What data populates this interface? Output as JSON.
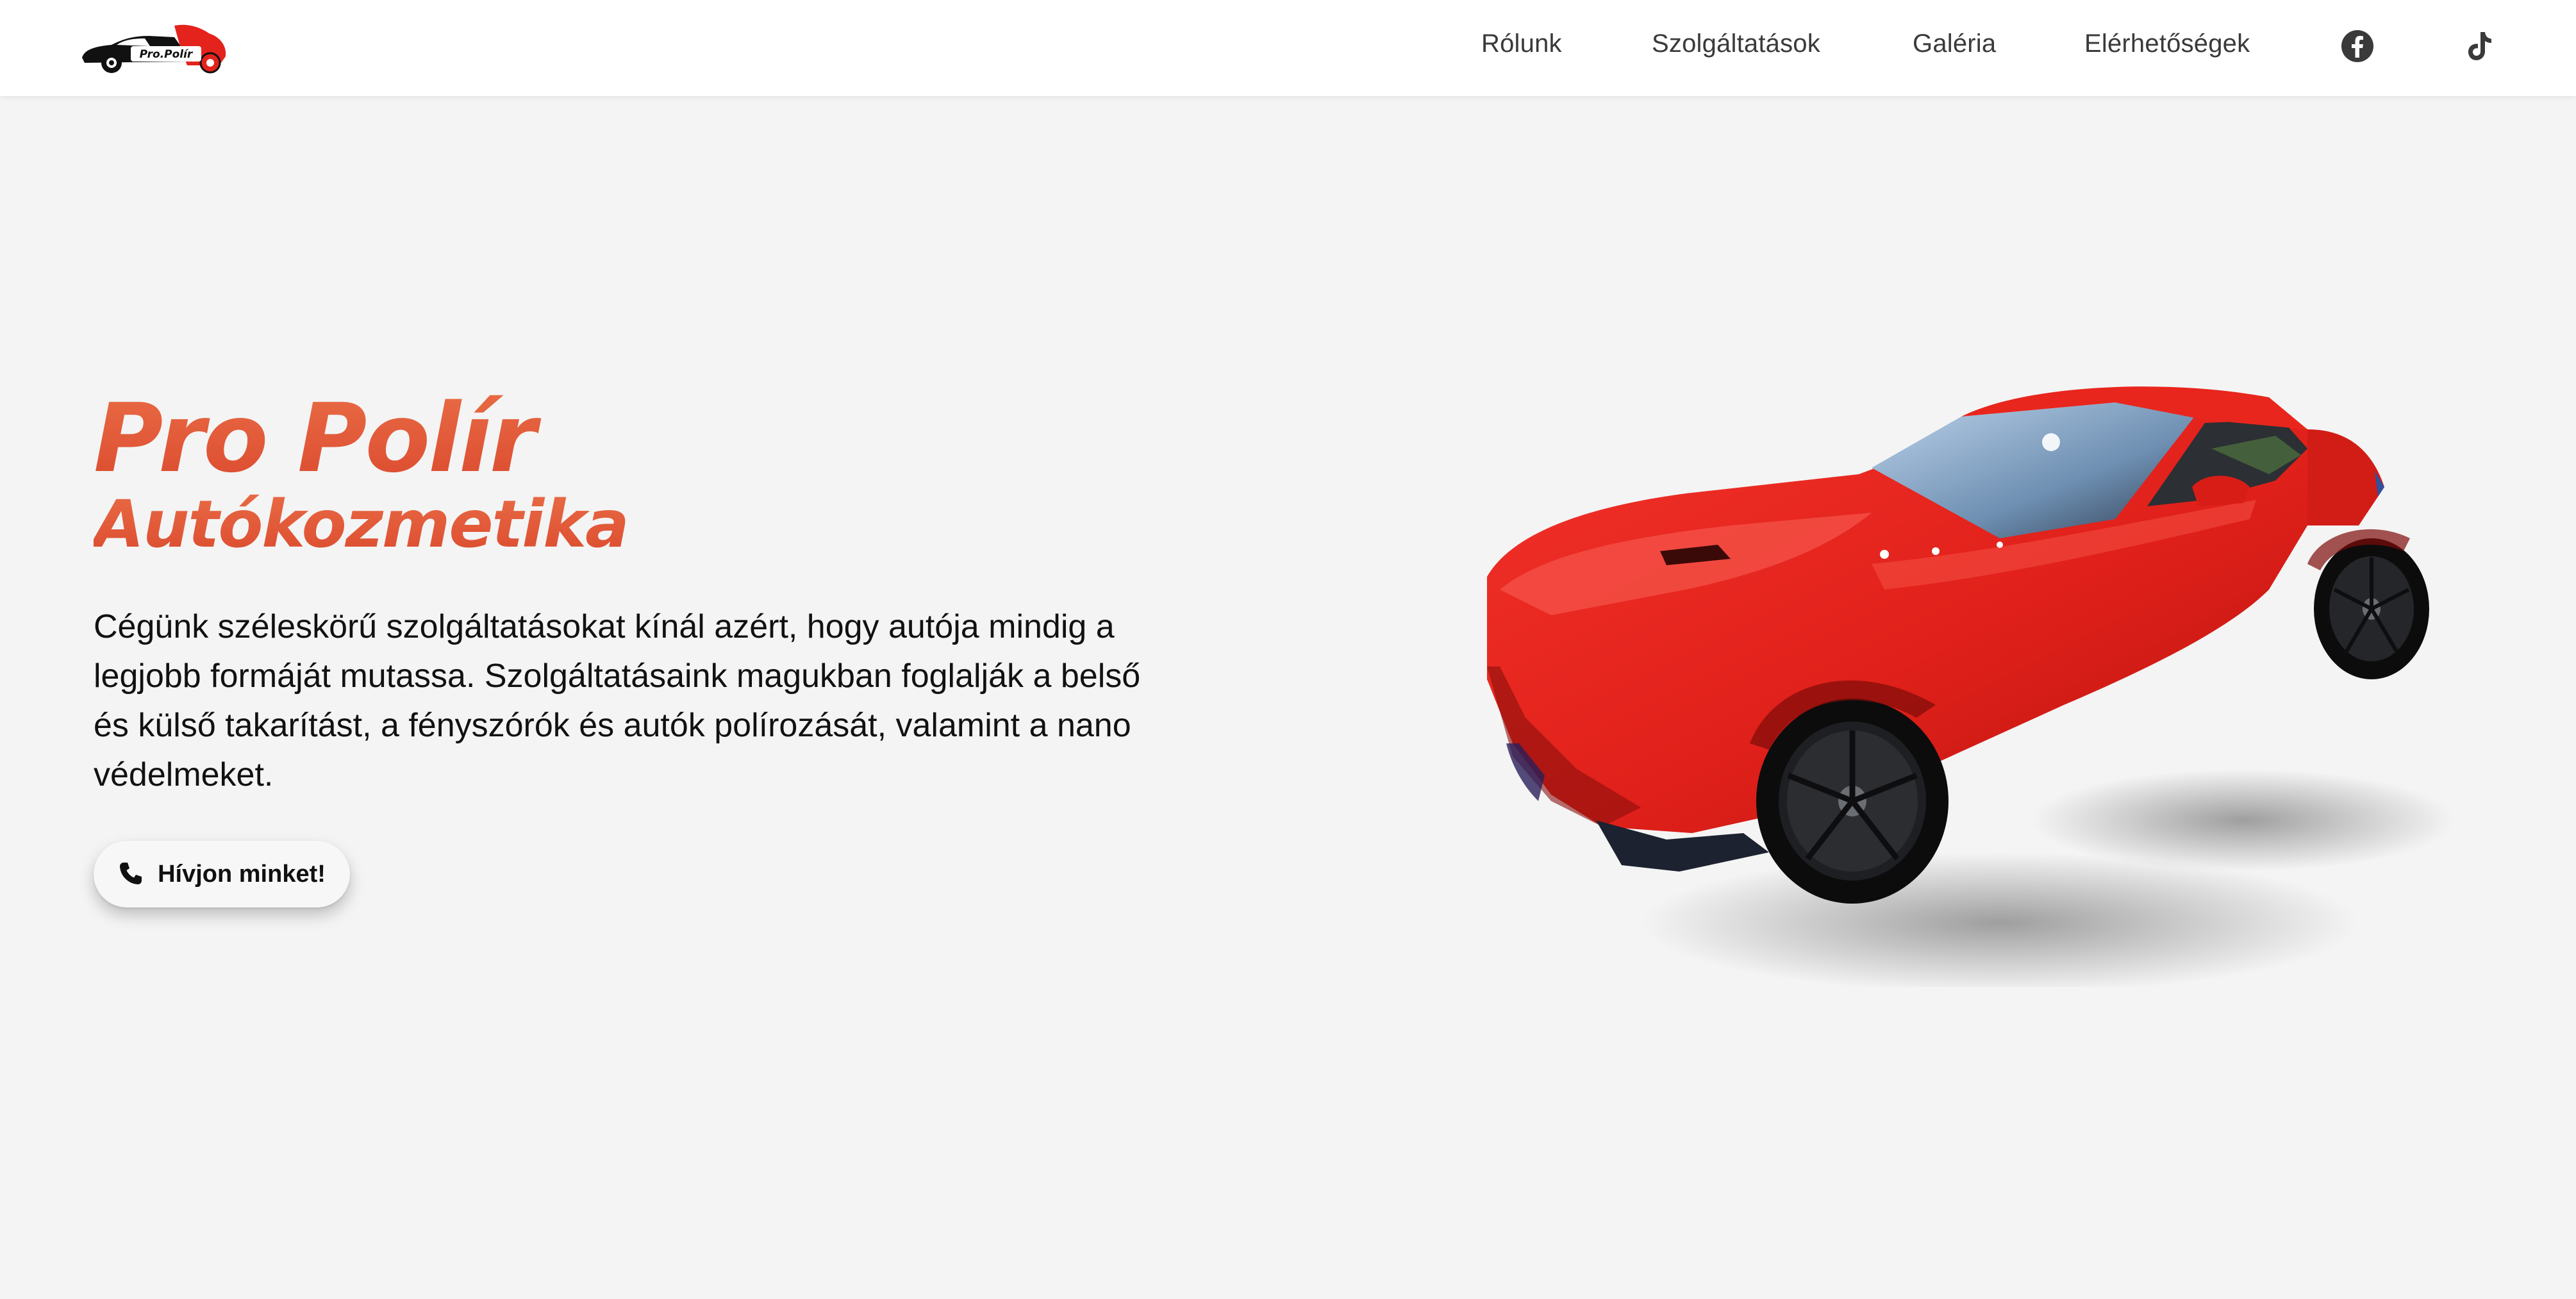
{
  "header": {
    "logo_text": "Pro.Polír",
    "nav": [
      {
        "label": "Rólunk"
      },
      {
        "label": "Szolgáltatások"
      },
      {
        "label": "Galéria"
      },
      {
        "label": "Elérhetőségek"
      }
    ],
    "social": [
      {
        "icon": "facebook-icon"
      },
      {
        "icon": "tiktok-icon"
      }
    ]
  },
  "hero": {
    "title": "Pro Polír",
    "subtitle": "Autókozmetika",
    "description": "Cégünk széleskörű szolgáltatásokat kínál azért, hogy autója mindig a legjobb formáját mutassa. Szolgáltatásaink magukban foglalják a belső és külső takarítást, a fényszórók és autók polírozását, valamint a nano védelmeket.",
    "cta_label": "Hívjon minket!",
    "cta_icon": "phone-icon"
  },
  "colors": {
    "accent": "#e0563a",
    "background": "#f4f4f4",
    "car_red": "#e3231c"
  }
}
